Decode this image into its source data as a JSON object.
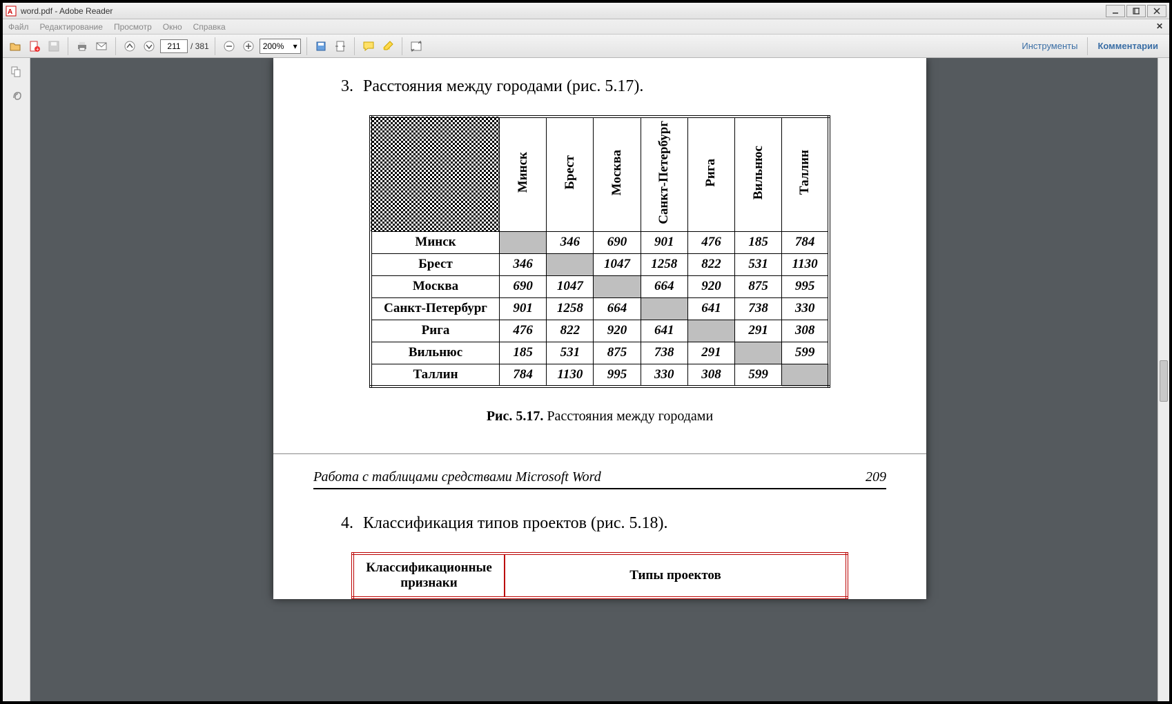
{
  "window": {
    "title": "word.pdf - Adobe Reader"
  },
  "menubar": {
    "file": "Файл",
    "edit": "Редактирование",
    "view": "Просмотр",
    "window": "Окно",
    "help": "Справка"
  },
  "toolbar": {
    "page_current": "211",
    "page_total": "/ 381",
    "zoom": "200%",
    "tools_link": "Инструменты",
    "comments_link": "Комментарии"
  },
  "doc": {
    "item3_num": "3.",
    "item3_text": "Расстояния между городами (рис. 5.17).",
    "table5_17": {
      "cols": [
        "Минск",
        "Брест",
        "Москва",
        "Санкт-Петербург",
        "Рига",
        "Вильнюс",
        "Таллин"
      ],
      "rows": [
        {
          "name": "Минск",
          "values": [
            "",
            "346",
            "690",
            "901",
            "476",
            "185",
            "784"
          ]
        },
        {
          "name": "Брест",
          "values": [
            "346",
            "",
            "1047",
            "1258",
            "822",
            "531",
            "1130"
          ]
        },
        {
          "name": "Москва",
          "values": [
            "690",
            "1047",
            "",
            "664",
            "920",
            "875",
            "995"
          ]
        },
        {
          "name": "Санкт-Петербург",
          "values": [
            "901",
            "1258",
            "664",
            "",
            "641",
            "738",
            "330"
          ]
        },
        {
          "name": "Рига",
          "values": [
            "476",
            "822",
            "920",
            "641",
            "",
            "291",
            "308"
          ]
        },
        {
          "name": "Вильнюс",
          "values": [
            "185",
            "531",
            "875",
            "738",
            "291",
            "",
            "599"
          ]
        },
        {
          "name": "Таллин",
          "values": [
            "784",
            "1130",
            "995",
            "330",
            "308",
            "599",
            ""
          ]
        }
      ]
    },
    "fig5_17_label": "Рис. 5.17.",
    "fig5_17_caption": "Расстояния между городами",
    "running_title": "Работа с таблицами средствами Microsoft Word",
    "page_number": "209",
    "item4_num": "4.",
    "item4_text": "Классификация типов проектов (рис. 5.18).",
    "table5_18": {
      "col1": "Классификационные признаки",
      "col2": "Типы проектов"
    }
  }
}
